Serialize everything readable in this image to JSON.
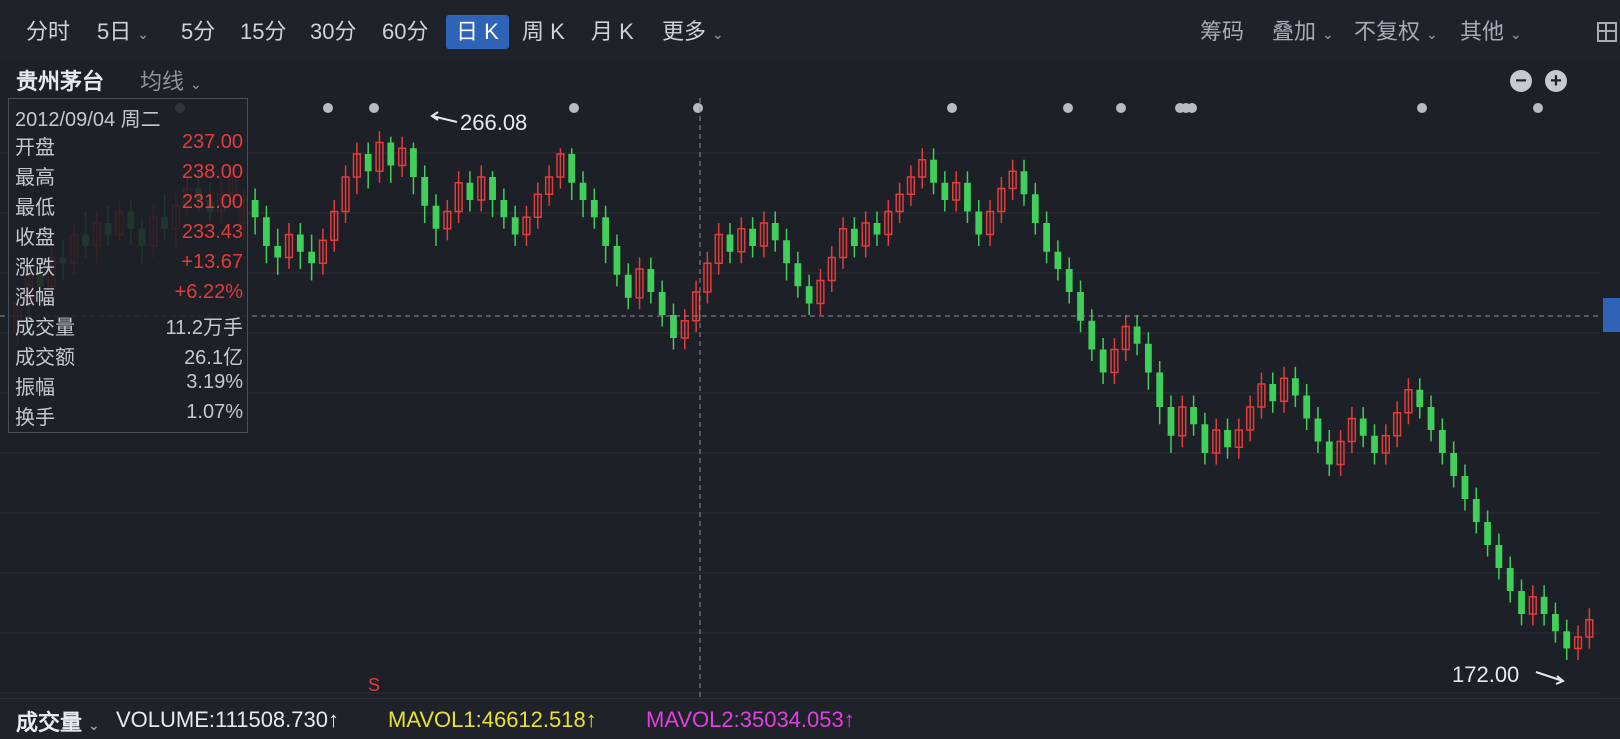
{
  "toolbar": {
    "tabs": [
      {
        "label": "分时"
      },
      {
        "label": "5日"
      },
      {
        "label": "5分"
      },
      {
        "label": "15分"
      },
      {
        "label": "30分"
      },
      {
        "label": "60分"
      },
      {
        "label": "日 K"
      },
      {
        "label": "周 K"
      },
      {
        "label": "月 K"
      },
      {
        "label": "更多"
      }
    ],
    "active_tab": "日 K",
    "right": [
      {
        "label": "筹码"
      },
      {
        "label": "叠加"
      },
      {
        "label": "不复权"
      },
      {
        "label": "其他"
      }
    ]
  },
  "subbar": {
    "stock_name": "贵州茅台",
    "ma_label": "均线",
    "zoom_out": "−",
    "zoom_in": "+"
  },
  "info_panel": {
    "date": "2012/09/04 周二",
    "rows": [
      {
        "label": "开盘",
        "value": "237.00",
        "color": "red"
      },
      {
        "label": "最高",
        "value": "238.00",
        "color": "red"
      },
      {
        "label": "最低",
        "value": "231.00",
        "color": "red"
      },
      {
        "label": "收盘",
        "value": "233.43",
        "color": "red"
      },
      {
        "label": "涨跌",
        "value": "+13.67",
        "color": "red"
      },
      {
        "label": "涨幅",
        "value": "+6.22%",
        "color": "red"
      },
      {
        "label": "成交量",
        "value": "11.2万手",
        "color": "neutral"
      },
      {
        "label": "成交额",
        "value": "26.1亿",
        "color": "neutral"
      },
      {
        "label": "振幅",
        "value": "3.19%",
        "color": "neutral"
      },
      {
        "label": "换手",
        "value": "1.07%",
        "color": "neutral"
      }
    ]
  },
  "chart_data": {
    "type": "candlestick",
    "high_label": "266.08",
    "low_label": "172.00",
    "marker": "S",
    "colors": {
      "up": "#e23c3c",
      "down": "#3fcf5a",
      "grid": "#2d3039",
      "crosshair": "#8a8e97"
    },
    "price_range": [
      170,
      270
    ],
    "candles": [
      [
        231,
        236,
        229,
        238
      ],
      [
        236,
        241,
        234,
        243
      ],
      [
        241,
        239,
        237,
        244
      ],
      [
        239,
        244,
        237,
        246
      ],
      [
        244,
        243,
        240,
        247
      ],
      [
        243,
        248,
        241,
        250
      ],
      [
        248,
        246,
        244,
        252
      ],
      [
        246,
        250,
        243,
        252
      ],
      [
        250,
        248,
        246,
        253
      ],
      [
        248,
        252,
        247,
        254
      ],
      [
        252,
        249,
        246,
        254
      ],
      [
        249,
        246,
        243,
        251
      ],
      [
        246,
        251,
        244,
        253
      ],
      [
        251,
        249,
        247,
        255
      ],
      [
        249,
        253,
        246,
        255
      ],
      [
        253,
        256,
        251,
        258
      ],
      [
        256,
        254,
        252,
        259
      ],
      [
        254,
        252,
        250,
        257
      ],
      [
        252,
        255,
        250,
        258
      ],
      [
        255,
        258,
        253,
        260
      ],
      [
        250,
        254,
        247,
        256
      ],
      [
        254,
        251,
        248,
        256
      ],
      [
        251,
        246,
        243,
        253
      ],
      [
        246,
        244,
        241,
        249
      ],
      [
        244,
        248,
        242,
        250
      ],
      [
        248,
        245,
        242,
        250
      ],
      [
        245,
        243,
        240,
        248
      ],
      [
        243,
        247,
        241,
        249
      ],
      [
        247,
        252,
        245,
        254
      ],
      [
        252,
        258,
        250,
        260
      ],
      [
        258,
        262,
        255,
        264
      ],
      [
        262,
        259,
        256,
        264
      ],
      [
        259,
        264,
        257,
        266
      ],
      [
        264,
        260,
        257,
        265
      ],
      [
        260,
        263,
        258,
        265
      ],
      [
        263,
        258,
        255,
        264
      ],
      [
        258,
        253,
        250,
        260
      ],
      [
        253,
        249,
        246,
        255
      ],
      [
        249,
        252,
        247,
        254
      ],
      [
        252,
        257,
        250,
        259
      ],
      [
        257,
        254,
        252,
        259
      ],
      [
        254,
        258,
        252,
        260
      ],
      [
        258,
        254,
        251,
        259
      ],
      [
        254,
        251,
        249,
        256
      ],
      [
        251,
        248,
        246,
        253
      ],
      [
        248,
        251,
        246,
        253
      ],
      [
        251,
        255,
        249,
        257
      ],
      [
        255,
        258,
        253,
        260
      ],
      [
        258,
        262,
        256,
        263
      ],
      [
        262,
        257,
        254,
        263
      ],
      [
        257,
        254,
        251,
        259
      ],
      [
        254,
        251,
        249,
        256
      ],
      [
        251,
        246,
        243,
        253
      ],
      [
        246,
        241,
        239,
        248
      ],
      [
        241,
        237,
        235,
        243
      ],
      [
        237,
        242,
        235,
        244
      ],
      [
        242,
        238,
        236,
        244
      ],
      [
        238,
        234,
        232,
        240
      ],
      [
        234,
        230,
        228,
        236
      ],
      [
        230,
        233,
        228,
        235
      ],
      [
        233,
        238,
        231,
        240
      ],
      [
        238,
        243,
        236,
        245
      ],
      [
        243,
        248,
        241,
        250
      ],
      [
        248,
        245,
        243,
        250
      ],
      [
        245,
        249,
        243,
        251
      ],
      [
        249,
        246,
        244,
        251
      ],
      [
        246,
        250,
        244,
        252
      ],
      [
        250,
        247,
        245,
        252
      ],
      [
        247,
        243,
        240,
        249
      ],
      [
        243,
        239,
        237,
        245
      ],
      [
        239,
        236,
        234,
        241
      ],
      [
        236,
        240,
        234,
        242
      ],
      [
        240,
        244,
        238,
        246
      ],
      [
        244,
        249,
        242,
        251
      ],
      [
        249,
        246,
        244,
        251
      ],
      [
        246,
        250,
        244,
        252
      ],
      [
        250,
        248,
        246,
        252
      ],
      [
        248,
        252,
        246,
        254
      ],
      [
        252,
        255,
        250,
        257
      ],
      [
        255,
        258,
        253,
        260
      ],
      [
        258,
        261,
        256,
        263
      ],
      [
        261,
        257,
        255,
        263
      ],
      [
        257,
        254,
        252,
        259
      ],
      [
        254,
        257,
        252,
        259
      ],
      [
        257,
        252,
        250,
        259
      ],
      [
        252,
        248,
        246,
        254
      ],
      [
        248,
        252,
        246,
        254
      ],
      [
        252,
        256,
        250,
        258
      ],
      [
        256,
        259,
        254,
        261
      ],
      [
        259,
        255,
        253,
        261
      ],
      [
        255,
        250,
        248,
        257
      ],
      [
        250,
        245,
        243,
        252
      ],
      [
        245,
        242,
        240,
        247
      ],
      [
        242,
        238,
        236,
        244
      ],
      [
        238,
        233,
        231,
        240
      ],
      [
        233,
        228,
        226,
        235
      ],
      [
        228,
        224,
        222,
        230
      ],
      [
        224,
        228,
        222,
        230
      ],
      [
        228,
        232,
        226,
        234
      ],
      [
        232,
        229,
        227,
        234
      ],
      [
        229,
        224,
        221,
        231
      ],
      [
        224,
        218,
        215,
        226
      ],
      [
        218,
        213,
        210,
        220
      ],
      [
        213,
        218,
        211,
        220
      ],
      [
        218,
        215,
        213,
        220
      ],
      [
        215,
        210,
        208,
        217
      ],
      [
        210,
        214,
        208,
        216
      ],
      [
        214,
        211,
        209,
        216
      ],
      [
        211,
        214,
        209,
        216
      ],
      [
        214,
        218,
        212,
        220
      ],
      [
        218,
        222,
        216,
        224
      ],
      [
        222,
        219,
        217,
        224
      ],
      [
        219,
        223,
        217,
        225
      ],
      [
        223,
        220,
        218,
        225
      ],
      [
        220,
        216,
        214,
        222
      ],
      [
        216,
        212,
        210,
        218
      ],
      [
        212,
        208,
        206,
        214
      ],
      [
        208,
        212,
        206,
        214
      ],
      [
        212,
        216,
        210,
        218
      ],
      [
        216,
        213,
        211,
        218
      ],
      [
        213,
        210,
        208,
        215
      ],
      [
        210,
        213,
        208,
        215
      ],
      [
        213,
        217,
        211,
        219
      ],
      [
        217,
        221,
        215,
        223
      ],
      [
        221,
        218,
        216,
        223
      ],
      [
        218,
        214,
        212,
        220
      ],
      [
        214,
        210,
        208,
        216
      ],
      [
        210,
        206,
        204,
        212
      ],
      [
        206,
        202,
        200,
        208
      ],
      [
        202,
        198,
        196,
        204
      ],
      [
        198,
        194,
        192,
        200
      ],
      [
        194,
        190,
        188,
        196
      ],
      [
        190,
        186,
        184,
        192
      ],
      [
        186,
        182,
        180,
        188
      ],
      [
        182,
        185,
        180,
        187
      ],
      [
        185,
        182,
        180,
        187
      ],
      [
        182,
        179,
        177,
        184
      ],
      [
        179,
        176,
        174,
        181
      ],
      [
        176,
        178,
        174,
        180
      ],
      [
        178,
        181,
        176,
        183
      ]
    ]
  },
  "volume_bar": {
    "label": "成交量",
    "volume": "VOLUME:111508.730↑",
    "mavol1": "MAVOL1:46612.518↑",
    "mavol2": "MAVOL2:35034.053↑"
  }
}
